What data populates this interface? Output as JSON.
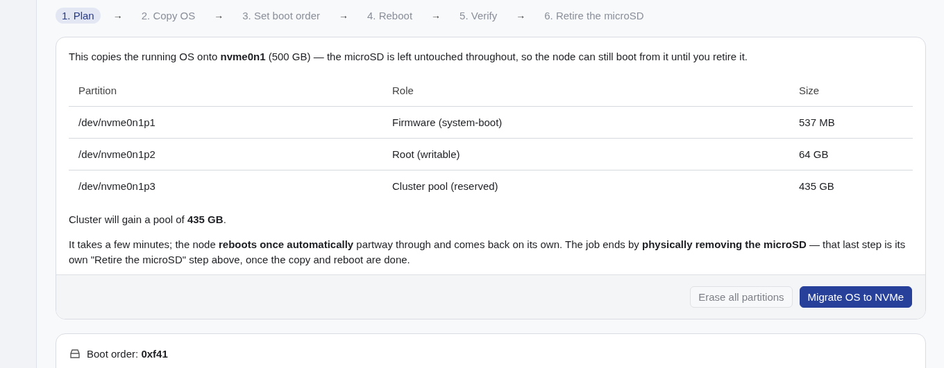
{
  "steps": [
    {
      "label": "1. Plan",
      "selected": true
    },
    {
      "label": "2. Copy OS",
      "selected": false
    },
    {
      "label": "3. Set boot order",
      "selected": false
    },
    {
      "label": "4. Reboot",
      "selected": false
    },
    {
      "label": "5. Verify",
      "selected": false
    },
    {
      "label": "6. Retire the microSD",
      "selected": false
    }
  ],
  "step_separator": "→",
  "plan_card": {
    "intro": "This copies the running OS onto **nvme0n1** (500 GB) — the microSD is left untouched throughout, so the node can still boot from it until you retire it.",
    "table": {
      "columns": [
        "Partition",
        "Role",
        "Size"
      ],
      "rows": [
        [
          "/dev/nvme0n1p1",
          "Firmware (system-boot)",
          "537 MB"
        ],
        [
          "/dev/nvme0n1p2",
          "Root (writable)",
          "64 GB"
        ],
        [
          "/dev/nvme0n1p3",
          "Cluster pool (reserved)",
          "435 GB"
        ]
      ]
    },
    "pool_note": "Cluster will gain a pool of **435 GB**.",
    "details": "It takes a few minutes; the node **reboots once automatically** partway through and comes back on its own. The job ends by **physically removing the microSD** — that last step is its own \"Retire the microSD\" step above, once the copy and reboot are done.",
    "buttons": [
      {
        "label": "Erase all partitions",
        "kind": "secondary",
        "disabled": true
      },
      {
        "label": "Migrate OS to NVMe",
        "kind": "primary",
        "disabled": false
      }
    ]
  },
  "boot_card": {
    "title": "Boot order: **0xf41**"
  }
}
